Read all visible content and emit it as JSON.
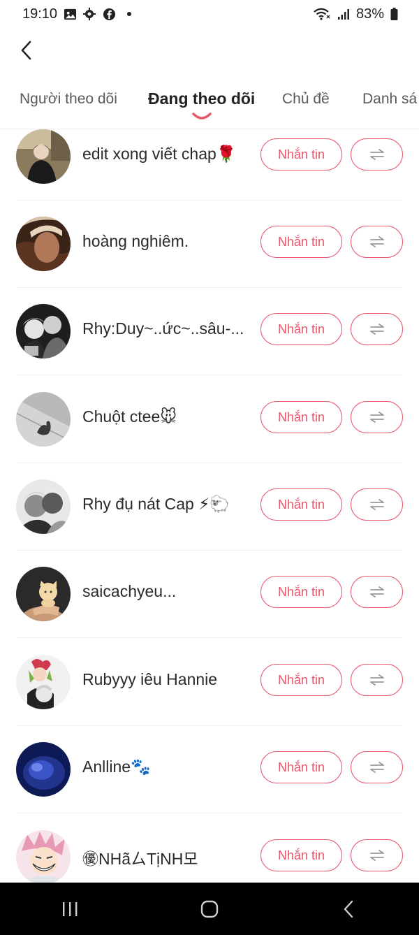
{
  "status_bar": {
    "time": "19:10",
    "battery": "83%",
    "icons_left": [
      "gallery-icon",
      "settings-icon",
      "facebook-icon",
      "dot-icon"
    ],
    "icons_right": [
      "wifi-icon",
      "signal-icon",
      "battery-icon"
    ]
  },
  "tabs": [
    {
      "label": "Người theo dõi",
      "active": false
    },
    {
      "label": "Đang theo dõi",
      "active": true
    },
    {
      "label": "Chủ đề",
      "active": false
    },
    {
      "label": "Danh sá",
      "active": false
    }
  ],
  "colors": {
    "accent": "#e8566b",
    "text": "#222222",
    "tab_inactive": "#5a5a5a",
    "nav_bar": "#000000"
  },
  "following": [
    {
      "name": "edit xong viết chap🌹",
      "message_label": "Nhắn tin"
    },
    {
      "name": "hoàng nghiêm.",
      "message_label": "Nhắn tin"
    },
    {
      "name": "Rhy:Duy~..ức~..sâu-...",
      "message_label": "Nhắn tin"
    },
    {
      "name": "Chuột ctee🐭",
      "message_label": "Nhắn tin"
    },
    {
      "name": "Rhy đụ nát Cap ⚡🐑",
      "message_label": "Nhắn tin"
    },
    {
      "name": "saicachyeu...",
      "message_label": "Nhắn tin"
    },
    {
      "name": "Rubyyy iêu Hannie",
      "message_label": "Nhắn tin"
    },
    {
      "name": "Anlline🐾",
      "message_label": "Nhắn tin"
    },
    {
      "name": "㊝NHãㄙTịNH모",
      "message_label": "Nhắn tin"
    }
  ],
  "nav": [
    "recents-icon",
    "home-icon",
    "back-icon"
  ]
}
